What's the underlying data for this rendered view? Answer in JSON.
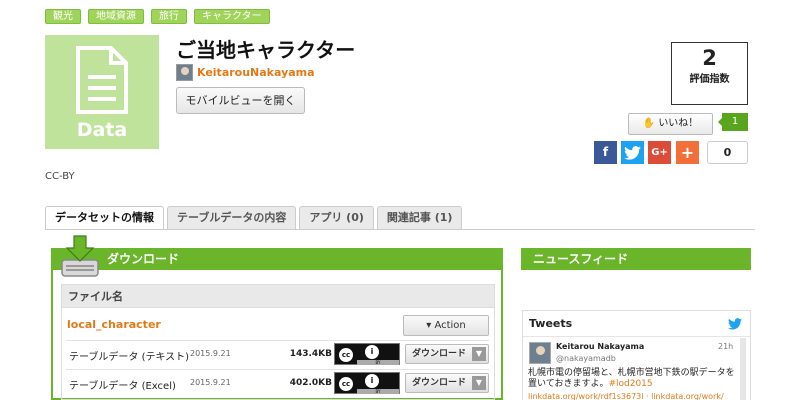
{
  "tags": [
    "観光",
    "地域資源",
    "旅行",
    "キャラクター"
  ],
  "data_icon": {
    "label": "Data"
  },
  "title": "ご当地キャラクター",
  "author": {
    "name": "KeitarouNakayama"
  },
  "mobile_view_button": "モバイルビューを開く",
  "license_label": "CC-BY",
  "rating": {
    "score": "2",
    "label": "評価指数"
  },
  "like": {
    "label": "いいね！",
    "count": "1"
  },
  "social": {
    "buttons": [
      {
        "name": "facebook",
        "glyph": "f",
        "color": "#3b5998"
      },
      {
        "name": "twitter",
        "glyph": "t",
        "color": "#1da1f2"
      },
      {
        "name": "google-plus",
        "glyph": "G+",
        "color": "#dd4b39"
      },
      {
        "name": "add",
        "glyph": "+",
        "color": "#f26f3a"
      }
    ],
    "share_count": "0"
  },
  "tabs": [
    {
      "label": "データセットの情報",
      "active": true
    },
    {
      "label": "テーブルデータの内容",
      "active": false
    },
    {
      "label": "アプリ (0)",
      "active": false
    },
    {
      "label": "関連記事 (1)",
      "active": false
    }
  ],
  "download_panel": {
    "title": "ダウンロード",
    "file_header": "ファイル名",
    "file_name": "local_character",
    "action_label": "Action",
    "rows": [
      {
        "name": "テーブルデータ (テキスト)",
        "date": "2015.9.21",
        "size": "143.4KB",
        "download": "ダウンロード"
      },
      {
        "name": "テーブルデータ (Excel)",
        "date": "2015.9.21",
        "size": "402.0KB",
        "download": "ダウンロード"
      }
    ]
  },
  "newsfeed": {
    "title": "ニュースフィード",
    "tweets_title": "Tweets",
    "tweet": {
      "name": "Keitarou Nakayama",
      "handle": "@nakayamadb",
      "time": "21h",
      "text": "札幌市電の停留場と、札幌市営地下鉄の駅データを置いておきますよ。",
      "hashtag": "#lod2015",
      "link": "linkdata.org/work/rdf1s3673i · linkdata.org/work/"
    }
  }
}
